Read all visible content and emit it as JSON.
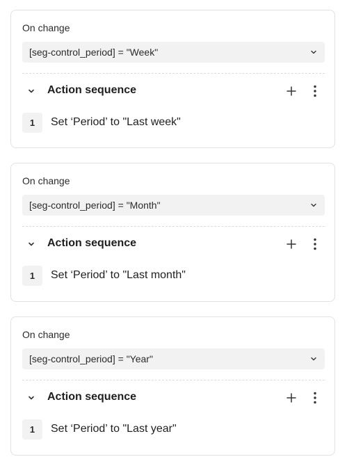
{
  "blocks": [
    {
      "trigger_label": "On change",
      "condition": "[seg-control_period] = \"Week\"",
      "sequence_title": "Action sequence",
      "actions": [
        {
          "number": "1",
          "text": "Set ‘Period’ to \"Last week\""
        }
      ]
    },
    {
      "trigger_label": "On change",
      "condition": "[seg-control_period] = \"Month\"",
      "sequence_title": "Action sequence",
      "actions": [
        {
          "number": "1",
          "text": "Set ‘Period’ to \"Last month\""
        }
      ]
    },
    {
      "trigger_label": "On change",
      "condition": "[seg-control_period] = \"Year\"",
      "sequence_title": "Action sequence",
      "actions": [
        {
          "number": "1",
          "text": "Set ‘Period’ to \"Last year\""
        }
      ]
    }
  ],
  "icons": {
    "dropdown": "chevron-down-icon",
    "collapse": "chevron-down-icon",
    "add": "plus-icon",
    "more": "more-vertical-icon"
  },
  "colors": {
    "field_background": "#f2f2f2",
    "border": "#e2e2e2",
    "text": "#1f1f1f"
  }
}
